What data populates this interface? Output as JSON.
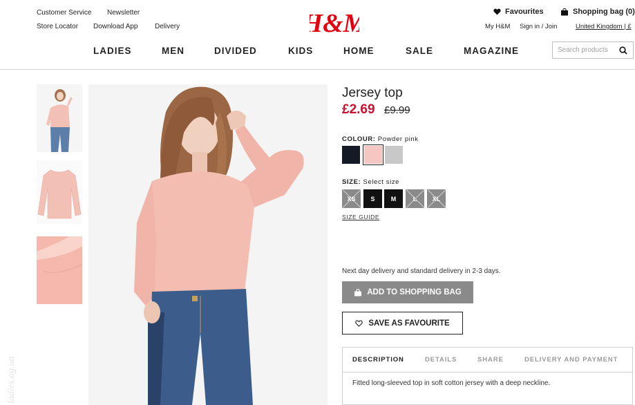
{
  "header": {
    "utility_links": [
      "Customer Service",
      "Newsletter",
      "Store Locator",
      "Download App",
      "Delivery"
    ],
    "logo_text": "H&M",
    "favourites_label": "Favourites",
    "shopping_bag_label": "Shopping bag (0)",
    "account_links": [
      "My H&M",
      "Sign in / Join",
      "United Kingdom | £"
    ],
    "nav": [
      "LADIES",
      "MEN",
      "DIVIDED",
      "KIDS",
      "HOME",
      "SALE",
      "MAGAZINE"
    ],
    "search_placeholder": "Search products"
  },
  "product": {
    "name": "Jersey top",
    "price": "£2.69",
    "old_price": "£9.99",
    "colour_label": "COLOUR:",
    "colour_value": "Powder pink",
    "colours": [
      {
        "name": "Dark blue",
        "hex": "#141a26"
      },
      {
        "name": "Powder pink",
        "hex": "#f6c7c2"
      },
      {
        "name": "Grey marl",
        "hex": "#c8c8c8"
      }
    ],
    "selected_colour_index": 1,
    "size_label": "SIZE:",
    "size_value": "Select size",
    "sizes": [
      {
        "label": "XS",
        "available": false
      },
      {
        "label": "S",
        "available": true
      },
      {
        "label": "M",
        "available": true
      },
      {
        "label": "L",
        "available": false
      },
      {
        "label": "XL",
        "available": false
      }
    ],
    "size_guide": "SIZE GUIDE",
    "delivery_text": "Next day delivery and standard delivery in 2-3 days.",
    "add_to_bag": "ADD TO SHOPPING BAG",
    "save_favourite": "SAVE AS FAVOURITE",
    "tabs": [
      "DESCRIPTION",
      "DETAILS",
      "SHARE",
      "DELIVERY AND PAYMENT"
    ],
    "active_tab": "DESCRIPTION",
    "description": "Fitted long-sleeved top in soft cotton jersey with a deep neckline."
  },
  "watermark": "ladies.ag.ua",
  "colors": {
    "brand_red": "#e50010",
    "sale_red": "#c8102e",
    "button_grey": "#8a8a8a",
    "text": "#222222"
  },
  "icons": [
    "heart-icon",
    "shopping-bag-icon",
    "search-icon",
    "bag-button-icon",
    "heart-outline-icon"
  ]
}
